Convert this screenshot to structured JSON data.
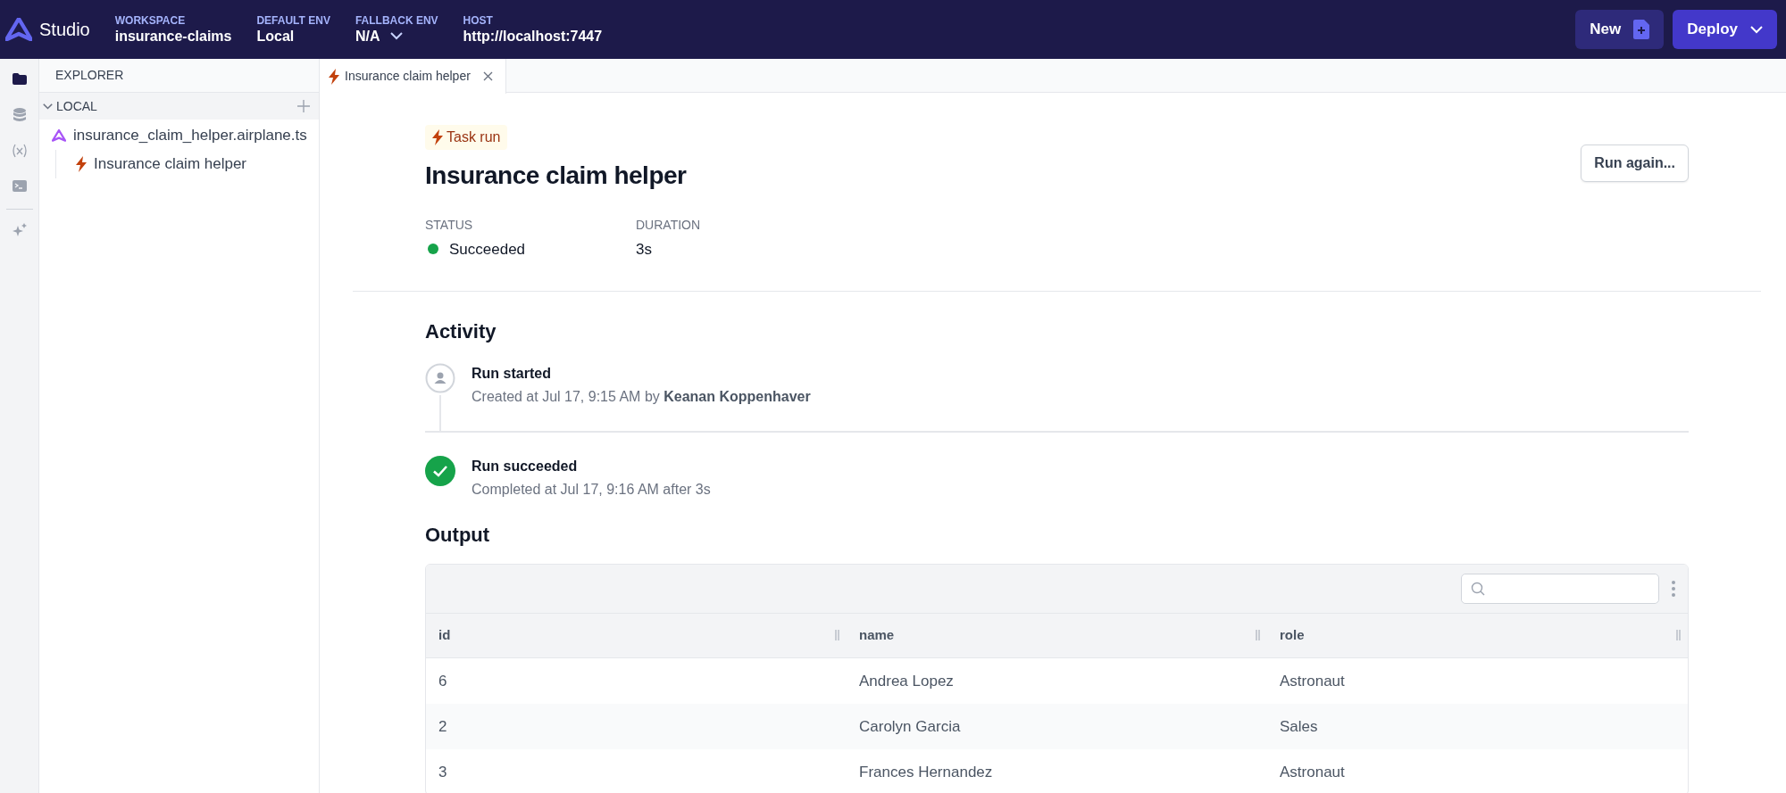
{
  "top_bar": {
    "brand": "Studio",
    "fields": [
      {
        "label": "WORKSPACE",
        "value": "insurance-claims",
        "dropdown": false
      },
      {
        "label": "DEFAULT ENV",
        "value": "Local",
        "dropdown": false
      },
      {
        "label": "FALLBACK ENV",
        "value": "N/A",
        "dropdown": true
      },
      {
        "label": "HOST",
        "value": "http://localhost:7447",
        "dropdown": false
      }
    ],
    "buttons": [
      {
        "label": "New",
        "kind": "new"
      },
      {
        "label": "Deploy",
        "kind": "deploy"
      }
    ]
  },
  "rail": {
    "items": [
      {
        "kind": "folder",
        "selected": true
      },
      {
        "kind": "database",
        "selected": false
      },
      {
        "kind": "variable",
        "selected": false
      },
      {
        "kind": "terminal",
        "selected": false
      },
      {
        "kind": "sparkles",
        "selected": false
      }
    ]
  },
  "explorer": {
    "title": "EXPLORER",
    "section": {
      "label": "LOCAL",
      "expanded": true
    },
    "tree": [
      {
        "label": "insurance_claim_helper.airplane.ts",
        "kind": "file",
        "children": [
          {
            "label": "Insurance claim helper",
            "kind": "task"
          }
        ]
      }
    ]
  },
  "tabs": [
    {
      "label": "Insurance claim helper",
      "selected": true
    }
  ],
  "run": {
    "badge": "Task run",
    "title": "Insurance claim helper",
    "action": "Run again...",
    "meta": [
      {
        "label": "STATUS",
        "value": "Succeeded",
        "color": "#16a34a"
      },
      {
        "label": "DURATION",
        "value": "3s"
      }
    ]
  },
  "activity": {
    "title": "Activity",
    "events": [
      {
        "kind": "started",
        "title": "Run started",
        "detail": "Created at Jul 17, 9:15 AM by **Keanan Koppenhaver**"
      },
      {
        "kind": "succeeded",
        "title": "Run succeeded",
        "detail": "Completed at Jul 17, 9:16 AM after 3s"
      }
    ]
  },
  "output": {
    "title": "Output",
    "table": {
      "columns": [
        "id",
        "name",
        "role"
      ],
      "rows": [
        [
          "6",
          "Andrea Lopez",
          "Astronaut"
        ],
        [
          "2",
          "Carolyn Garcia",
          "Sales"
        ],
        [
          "3",
          "Frances Hernandez",
          "Astronaut"
        ]
      ]
    }
  }
}
